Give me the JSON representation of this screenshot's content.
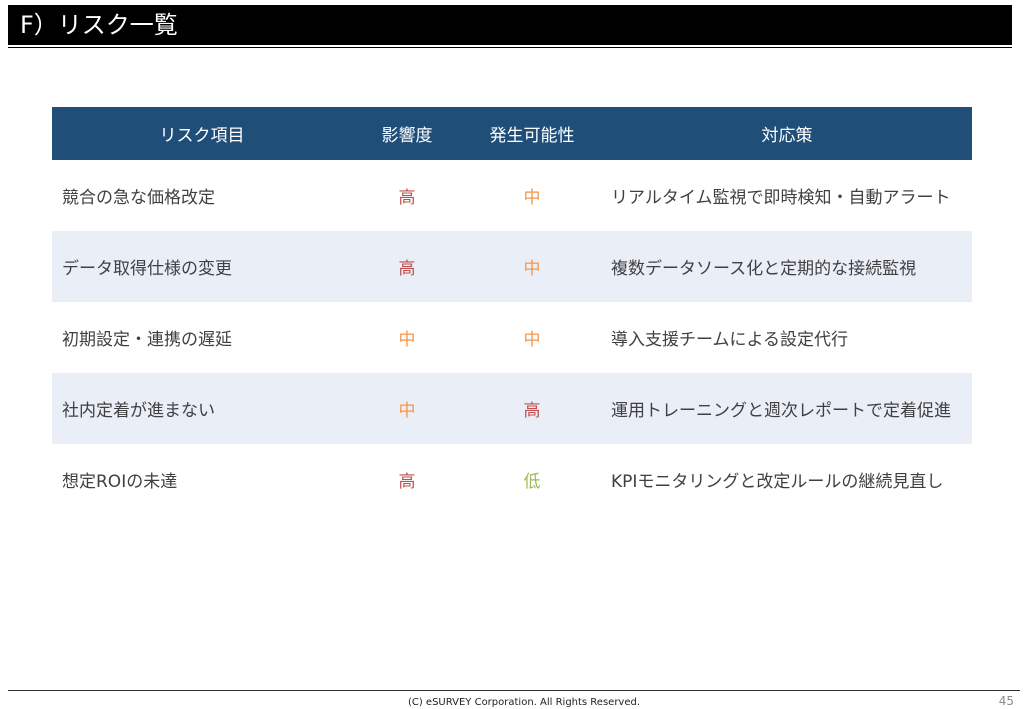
{
  "slide": {
    "title": "F）リスク一覧",
    "footer": "(C) eSURVEY Corporation. All Rights Reserved.",
    "page_number": "45"
  },
  "table": {
    "headers": {
      "item": "リスク項目",
      "impact": "影響度",
      "probability": "発生可能性",
      "measure": "対応策"
    },
    "rows": [
      {
        "item": "競合の急な価格改定",
        "impact": "高",
        "probability": "中",
        "measure": "リアルタイム監視で即時検知・自動アラート"
      },
      {
        "item": "データ取得仕様の変更",
        "impact": "高",
        "probability": "中",
        "measure": "複数データソース化と定期的な接続監視"
      },
      {
        "item": "初期設定・連携の遅延",
        "impact": "中",
        "probability": "中",
        "measure": "導入支援チームによる設定代行"
      },
      {
        "item": "社内定着が進まない",
        "impact": "中",
        "probability": "高",
        "measure": "運用トレーニングと週次レポートで定着促進"
      },
      {
        "item": "想定ROIの未達",
        "impact": "高",
        "probability": "低",
        "measure": "KPIモニタリングと改定ルールの継続見直し"
      }
    ]
  },
  "level_colors": {
    "高": "#c0504d",
    "中": "#f79646",
    "低": "#9bbb59"
  },
  "colors": {
    "header_bg": "#1f4e79",
    "row_shade": "#eaeff7"
  }
}
